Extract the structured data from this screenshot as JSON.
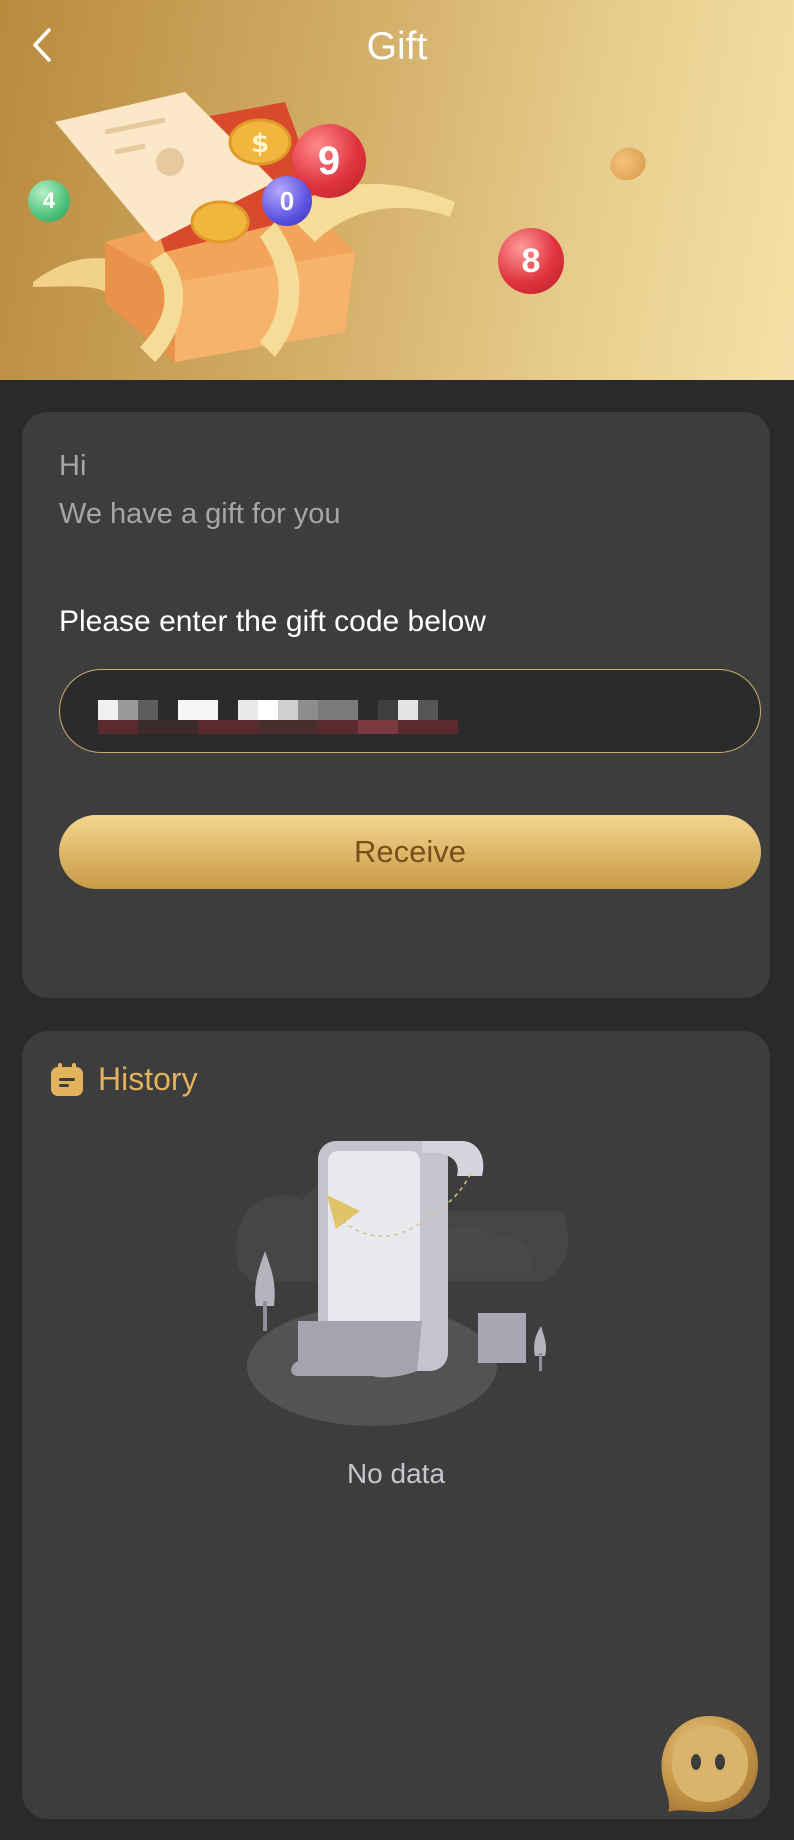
{
  "header": {
    "title": "Gift",
    "back_icon": "chevron-left-icon",
    "balls": [
      "9",
      "4",
      "0",
      "8"
    ]
  },
  "gift": {
    "greeting_hi": "Hi",
    "greeting_text": "We have a gift for you",
    "prompt": "Please enter the gift code below",
    "code_value": "",
    "receive_label": "Receive"
  },
  "history": {
    "title": "History",
    "icon": "calendar-icon",
    "empty_text": "No data"
  },
  "colors": {
    "accent_gold": "#e3b25c",
    "button_text": "#7a4e1b",
    "card_bg": "#3d3d3d",
    "page_bg": "#2a2a2a"
  }
}
